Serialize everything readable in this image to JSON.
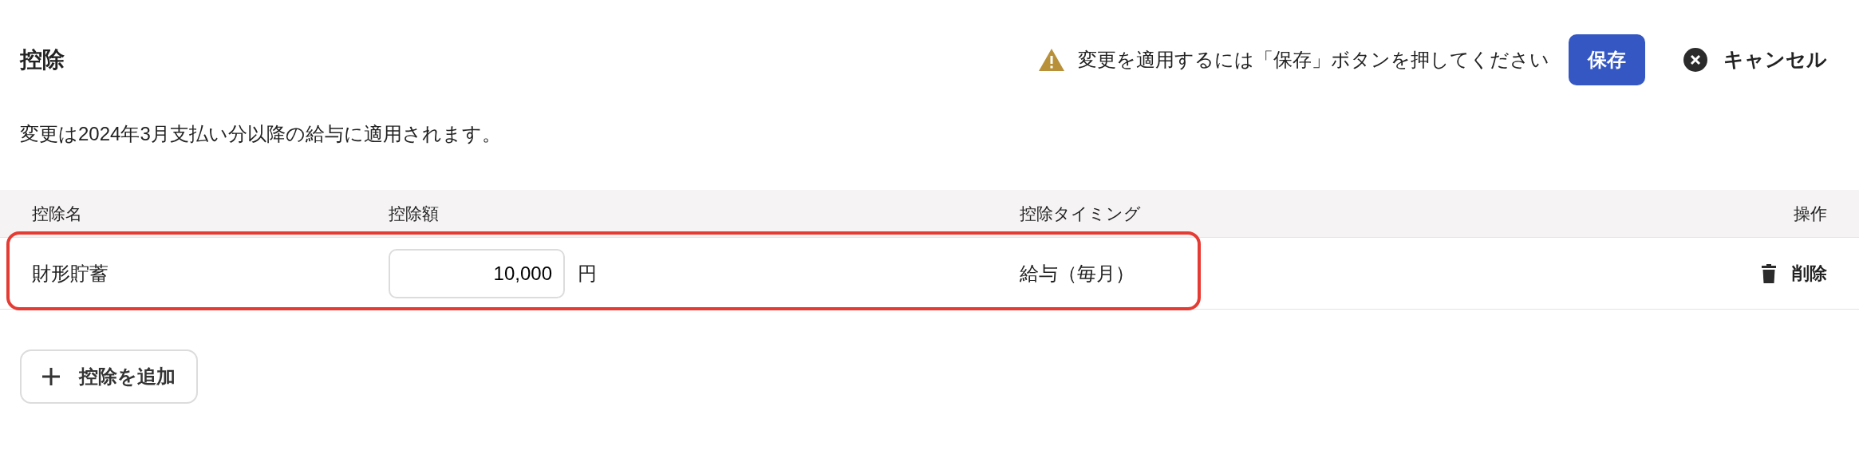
{
  "title": "控除",
  "notice": {
    "text": "変更を適用するには「保存」ボタンを押してください"
  },
  "buttons": {
    "save": "保存",
    "cancel": "キャンセル"
  },
  "description": "変更は2024年3月支払い分以降の給与に適用されます。",
  "table": {
    "columns": [
      "控除名",
      "控除額",
      "控除タイミング",
      "操作"
    ],
    "rows": [
      {
        "name": "財形貯蓄",
        "amount": "10,000",
        "unit": "円",
        "timing": "給与（毎月）",
        "action": "削除",
        "highlighted": true
      }
    ]
  },
  "add_button": "控除を追加"
}
